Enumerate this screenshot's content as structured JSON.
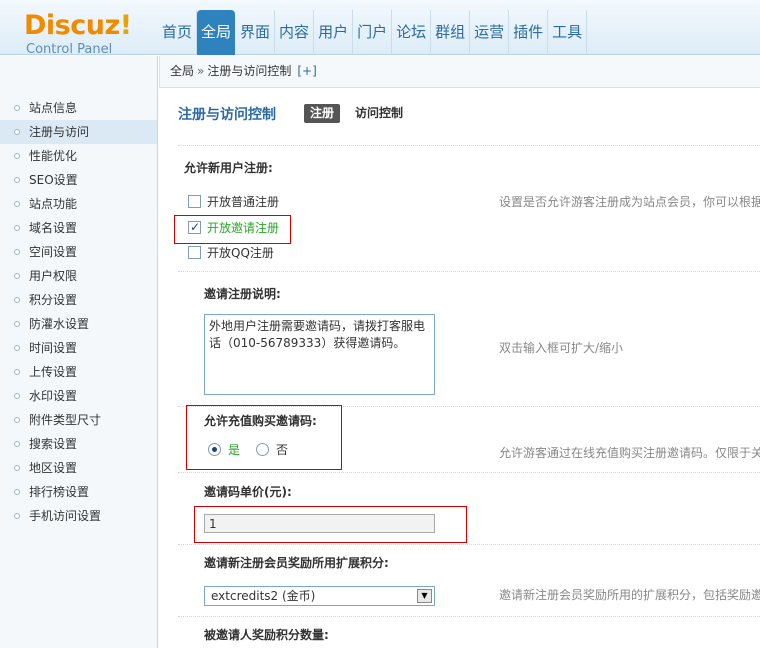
{
  "logo": {
    "brand": "Discuz",
    "bang": "!",
    "subtitle": "Control Panel"
  },
  "topnav": {
    "items": [
      {
        "label": "首页",
        "active": false
      },
      {
        "label": "全局",
        "active": true
      },
      {
        "label": "界面",
        "active": false
      },
      {
        "label": "内容",
        "active": false
      },
      {
        "label": "用户",
        "active": false
      },
      {
        "label": "门户",
        "active": false
      },
      {
        "label": "论坛",
        "active": false
      },
      {
        "label": "群组",
        "active": false
      },
      {
        "label": "运营",
        "active": false
      },
      {
        "label": "插件",
        "active": false
      },
      {
        "label": "工具",
        "active": false
      }
    ]
  },
  "sidebar": {
    "items": [
      {
        "label": "站点信息",
        "active": false
      },
      {
        "label": "注册与访问",
        "active": true
      },
      {
        "label": "性能优化",
        "active": false
      },
      {
        "label": "SEO设置",
        "active": false
      },
      {
        "label": "站点功能",
        "active": false
      },
      {
        "label": "域名设置",
        "active": false
      },
      {
        "label": "空间设置",
        "active": false
      },
      {
        "label": "用户权限",
        "active": false
      },
      {
        "label": "积分设置",
        "active": false
      },
      {
        "label": "防灌水设置",
        "active": false
      },
      {
        "label": "时间设置",
        "active": false
      },
      {
        "label": "上传设置",
        "active": false
      },
      {
        "label": "水印设置",
        "active": false
      },
      {
        "label": "附件类型尺寸",
        "active": false
      },
      {
        "label": "搜索设置",
        "active": false
      },
      {
        "label": "地区设置",
        "active": false
      },
      {
        "label": "排行榜设置",
        "active": false
      },
      {
        "label": "手机访问设置",
        "active": false
      }
    ]
  },
  "breadcrumb": {
    "root": "全局",
    "separator": "»",
    "current": "注册与访问控制",
    "add": "[+]"
  },
  "main": {
    "title": "注册与访问控制",
    "tab_active": "注册",
    "tab_other": "访问控制",
    "allow_register": {
      "label": "允许新用户注册:",
      "tip": "设置是否允许游客注册成为站点会员，你可以根据",
      "options": [
        {
          "label": "开放普通注册",
          "checked": false
        },
        {
          "label": "开放邀请注册",
          "checked": true
        },
        {
          "label": "开放QQ注册",
          "checked": false
        }
      ]
    },
    "invite_desc": {
      "label": "邀请注册说明:",
      "value": "外地用户注册需要邀请码，请拨打客服电话（010-56789333）获得邀请码。",
      "tip": "双击输入框可扩大/缩小"
    },
    "buy_invite": {
      "label": "允许充值购买邀请码:",
      "yes": "是",
      "no": "否",
      "selected": "yes",
      "tip": "允许游客通过在线充值购买注册邀请码。仅限于关"
    },
    "invite_price": {
      "label": "邀请码单价(元):",
      "value": "1"
    },
    "reward_credit": {
      "label": "邀请新注册会员奖励所用扩展积分:",
      "selected": "extcredits2 (金币)",
      "tip": "邀请新注册会员奖励所用的扩展积分，包括奖励邀"
    },
    "invitee_reward": {
      "label": "被邀请人奖励积分数量:"
    }
  },
  "colors": {
    "accent": "#2e83bf",
    "highlight_box": "#d60000",
    "checked_text": "#2aa52a"
  }
}
